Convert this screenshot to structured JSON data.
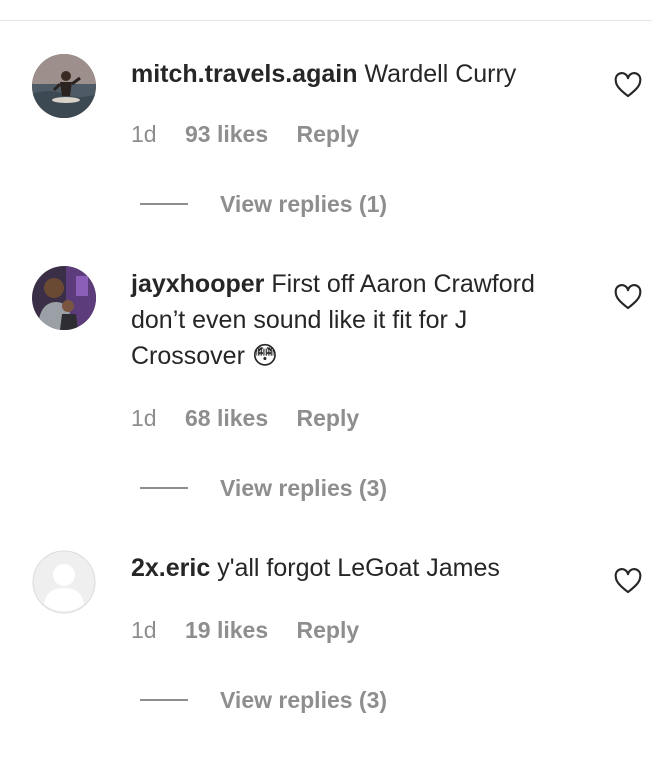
{
  "comments": [
    {
      "username": "mitch.travels.again",
      "text": "Wardell Curry",
      "age": "1d",
      "likes": "93 likes",
      "reply_label": "Reply",
      "view_replies": "View replies (1)",
      "avatar_icon": "avatar-photo-surfer"
    },
    {
      "username": "jayxhooper",
      "text": "First off Aaron Crawford don’t even sound like it fit for J Crossover",
      "emoji": "😳",
      "age": "1d",
      "likes": "68 likes",
      "reply_label": "Reply",
      "view_replies": "View replies (3)",
      "avatar_icon": "avatar-photo-person"
    },
    {
      "username": "2x.eric",
      "text": "y'all forgot LeGoat James",
      "age": "1d",
      "likes": "19 likes",
      "reply_label": "Reply",
      "view_replies": "View replies (3)",
      "avatar_icon": "default-avatar-icon"
    }
  ],
  "colors": {
    "primary_text": "#262626",
    "secondary_text": "#8e8e8e",
    "divider": "#e6e6e6"
  }
}
